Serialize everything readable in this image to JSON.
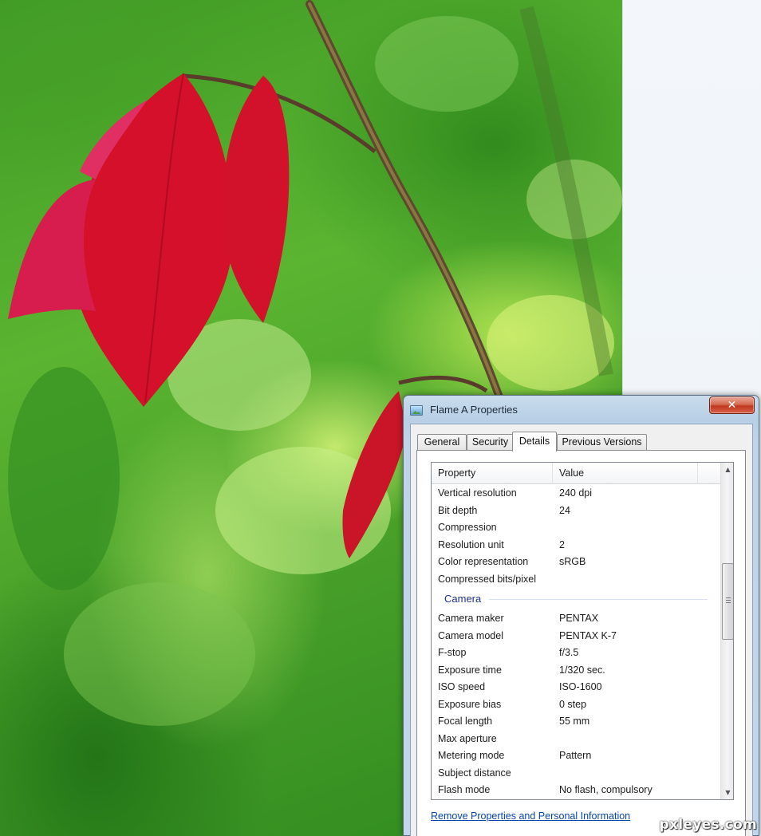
{
  "dialog": {
    "title": "Flame A Properties",
    "close_label": "✕",
    "tabs": [
      {
        "label": "General",
        "active": false
      },
      {
        "label": "Security",
        "active": false
      },
      {
        "label": "Details",
        "active": true
      },
      {
        "label": "Previous Versions",
        "active": false
      }
    ],
    "list": {
      "columns": {
        "property": "Property",
        "value": "Value"
      },
      "rows_top": [
        {
          "property": "Vertical resolution",
          "value": "240 dpi"
        },
        {
          "property": "Bit depth",
          "value": "24"
        },
        {
          "property": "Compression",
          "value": ""
        },
        {
          "property": "Resolution unit",
          "value": "2"
        },
        {
          "property": "Color representation",
          "value": "sRGB"
        },
        {
          "property": "Compressed bits/pixel",
          "value": ""
        }
      ],
      "group_camera": "Camera",
      "rows_camera": [
        {
          "property": "Camera maker",
          "value": "PENTAX"
        },
        {
          "property": "Camera model",
          "value": "PENTAX K-7"
        },
        {
          "property": "F-stop",
          "value": "f/3.5"
        },
        {
          "property": "Exposure time",
          "value": "1/320 sec."
        },
        {
          "property": "ISO speed",
          "value": "ISO-1600"
        },
        {
          "property": "Exposure bias",
          "value": "0 step"
        },
        {
          "property": "Focal length",
          "value": "55 mm"
        },
        {
          "property": "Max aperture",
          "value": ""
        },
        {
          "property": "Metering mode",
          "value": "Pattern"
        },
        {
          "property": "Subject distance",
          "value": ""
        },
        {
          "property": "Flash mode",
          "value": "No flash, compulsory"
        }
      ],
      "scroll_up": "▲",
      "scroll_down": "▼"
    },
    "remove_link": "Remove Properties and Personal Information"
  },
  "watermark": "pxleyes.com",
  "icons": {
    "title": "image-file-icon",
    "close": "close-icon",
    "scroll_up": "scroll-up-arrow-icon",
    "scroll_down": "scroll-down-arrow-icon"
  },
  "colors": {
    "link": "#0645ad",
    "group_header": "#1e3287",
    "close_button": "#c0391f"
  }
}
